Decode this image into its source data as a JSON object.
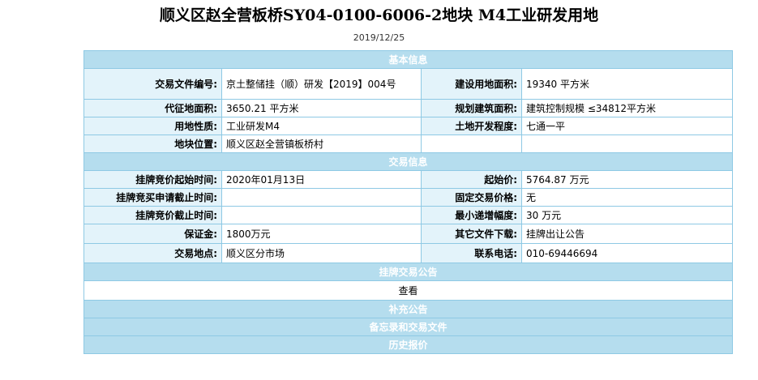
{
  "header": {
    "title": "顺义区赵全营板桥SY04-0100-6006-2地块 M4工业研发用地",
    "date": "2019/12/25"
  },
  "sections": {
    "basic": "基本信息",
    "trade": "交易信息",
    "announcement": "挂牌交易公告",
    "view_link": "查看",
    "supplement": "补充公告",
    "memo": "备忘录和交易文件",
    "history": "历史报价"
  },
  "basic": {
    "doc_no_label": "交易文件编号:",
    "doc_no_value": "京土整储挂（顺）研发【2019】004号",
    "land_area_label": "建设用地面积:",
    "land_area_value": "19340 平方米",
    "levy_area_label": "代征地面积:",
    "levy_area_value": "3650.21 平方米",
    "build_area_label": "规划建筑面积:",
    "build_area_value": "建筑控制规模 ≤34812平方米",
    "usage_label": "用地性质:",
    "usage_value": "工业研发M4",
    "dev_level_label": "土地开发程度:",
    "dev_level_value": "七通一平",
    "location_label": "地块位置:",
    "location_value": "顺义区赵全营镇板桥村"
  },
  "trade": {
    "start_time_label": "挂牌竞价起始时间:",
    "start_time_value": "2020年01月13日",
    "start_price_label": "起始价:",
    "start_price_value": "5764.87 万元",
    "apply_deadline_label": "挂牌竞买申请截止时间:",
    "apply_deadline_value": "",
    "fixed_price_label": "固定交易价格:",
    "fixed_price_value": "无",
    "bid_deadline_label": "挂牌竞价截止时间:",
    "bid_deadline_value": "",
    "min_increment_label": "最小递增幅度:",
    "min_increment_value": "30 万元",
    "deposit_label": "保证金:",
    "deposit_value": "1800万元",
    "other_docs_label": "其它文件下载:",
    "other_docs_value": "挂牌出让公告",
    "place_label": "交易地点:",
    "place_value": "顺义区分市场",
    "phone_label": "联系电话:",
    "phone_value": "010-69446694"
  }
}
